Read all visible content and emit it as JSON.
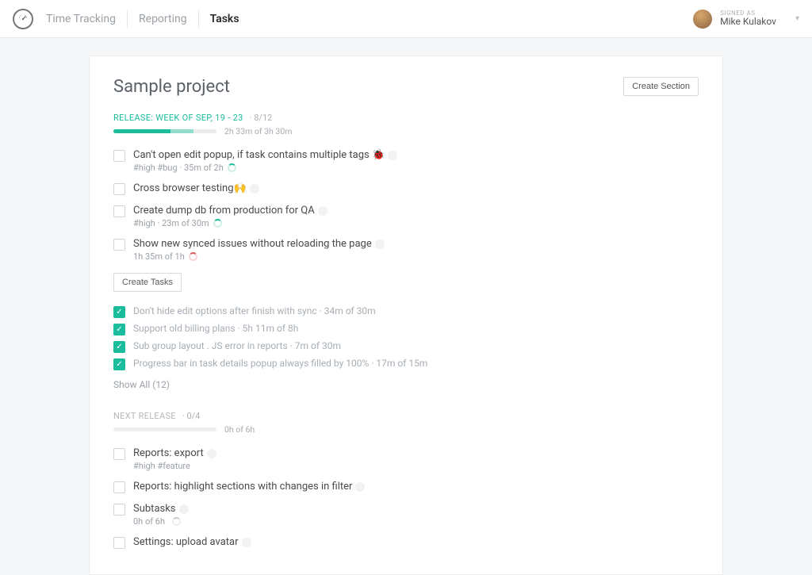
{
  "header": {
    "nav": [
      "Time Tracking",
      "Reporting",
      "Tasks"
    ],
    "active_index": 2,
    "signed_as_label": "SIGNED AS",
    "user_name": "Mike Kulakov"
  },
  "project": {
    "title": "Sample project",
    "create_section_label": "Create Section"
  },
  "section1": {
    "label": "RELEASE: WEEK OF SEP, 19 - 23",
    "count": "8/12",
    "time": "2h 33m of 3h 30m",
    "progress_done_pct": 55,
    "progress_partial_pct": 78,
    "tasks": [
      {
        "title": "Can't open edit popup, if task contains multiple tags 🐞",
        "meta": "#high #bug · 35m of 2h",
        "spinner": "green"
      },
      {
        "title": "Cross browser testing🙌",
        "meta": "",
        "spinner": ""
      },
      {
        "title": "Create dump db from production for QA",
        "meta": "#high · 23m of 30m",
        "spinner": "green"
      },
      {
        "title": "Show new synced issues without reloading the page",
        "meta": "1h 35m of 1h",
        "spinner": "red"
      }
    ],
    "create_tasks_label": "Create Tasks",
    "completed": [
      "Don't hide edit options after finish with sync · 34m of 30m",
      "Support old billing plans · 5h 11m of 8h",
      "Sub group layout . JS error in reports · 7m of 30m",
      "Progress bar in task details popup always filled by 100% · 17m of 15m"
    ],
    "show_all_label": "Show All (12)"
  },
  "section2": {
    "label": "NEXT RELEASE",
    "count": "0/4",
    "time": "0h of 6h",
    "tasks": [
      {
        "title": "Reports: export",
        "meta": "#high #feature",
        "spinner": ""
      },
      {
        "title": "Reports: highlight sections with changes in filter",
        "meta": "",
        "spinner": ""
      },
      {
        "title": "Subtasks",
        "meta": "0h of 6h",
        "spinner": "grey"
      },
      {
        "title": "Settings: upload avatar",
        "meta": "",
        "spinner": ""
      }
    ]
  }
}
